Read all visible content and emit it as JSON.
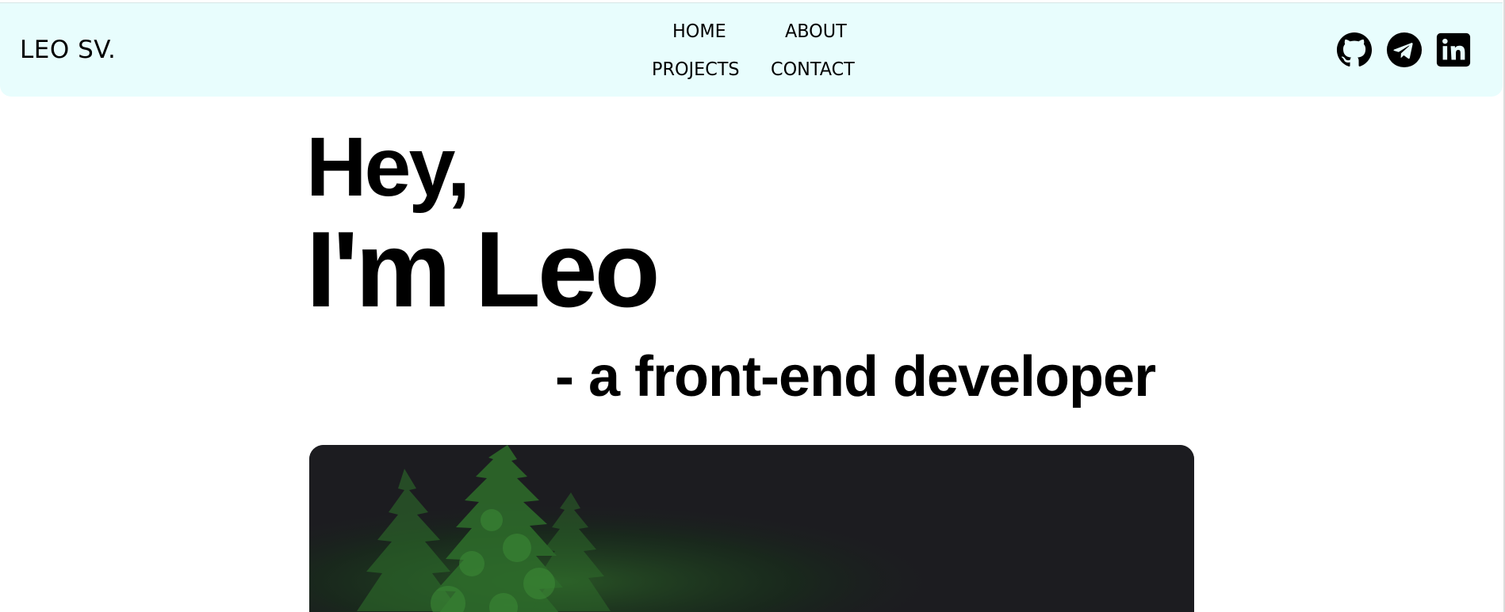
{
  "header": {
    "logo": "LEO SV.",
    "nav": {
      "home": "HOME",
      "about": "ABOUT",
      "projects": "PROJECTS",
      "contact": "CONTACT"
    },
    "social_icons": [
      "github-icon",
      "telegram-icon",
      "linkedin-icon"
    ]
  },
  "hero": {
    "greeting": "Hey,",
    "name_line": "I'm Leo",
    "role": "- a front-end developer"
  },
  "colors": {
    "navbar_background": "#e8fdfd",
    "text": "#000000",
    "image_background": "#1c1c20",
    "foliage": "#2f7a2c"
  }
}
